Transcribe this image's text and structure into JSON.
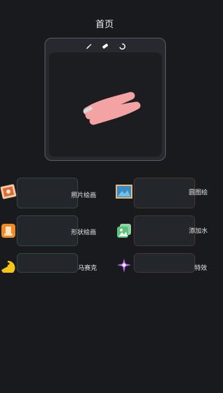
{
  "header": {
    "title": "首页"
  },
  "toolbar": {
    "icons": [
      "brush-icon",
      "eraser-icon",
      "refresh-icon"
    ]
  },
  "canvas": {
    "stroke_color": "#f3a3a3"
  },
  "features": [
    {
      "label": "照片绘画",
      "icon": "photo-frame-icon",
      "border": "#2f4a3c"
    },
    {
      "label": "圆图绘",
      "icon": "landscape-picture-icon",
      "border": "#4a3630"
    },
    {
      "label": "形状绘画",
      "icon": "shape-tag-icon",
      "border": "#2f4a3c"
    },
    {
      "label": "添加水",
      "icon": "stacked-image-icon",
      "border": "#4a3630"
    },
    {
      "label": "马赛克",
      "icon": "pacman-icon",
      "border": "#2f4a3c"
    },
    {
      "label": "特效",
      "icon": "sparkle-effect-icon",
      "border": "#4a3630"
    }
  ]
}
